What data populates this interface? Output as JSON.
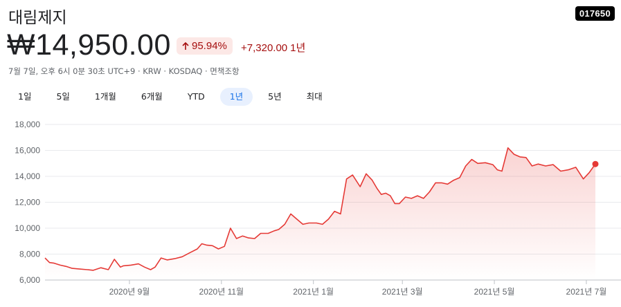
{
  "header": {
    "name": "대림제지",
    "ticker": "017650",
    "price": "₩14,950.00",
    "change_pct": "95.94%",
    "change_abs": "+7,320.00",
    "change_period": "1년",
    "meta": "7월 7일, 오후 6시 0분 30초 UTC+9 · KRW · KOSDAQ · 면책조항"
  },
  "colors": {
    "line": "#e53935",
    "fill": "#fce8e6",
    "text": "#5f6368",
    "active_tab": "#1a73e8"
  },
  "ranges": [
    {
      "label": "1일",
      "active": false
    },
    {
      "label": "5일",
      "active": false
    },
    {
      "label": "1개월",
      "active": false
    },
    {
      "label": "6개월",
      "active": false
    },
    {
      "label": "YTD",
      "active": false
    },
    {
      "label": "1년",
      "active": true
    },
    {
      "label": "5년",
      "active": false
    },
    {
      "label": "최대",
      "active": false
    }
  ],
  "chart_data": {
    "type": "area",
    "ylim": [
      6000,
      18000
    ],
    "y_ticks": [
      6000,
      8000,
      10000,
      12000,
      14000,
      16000,
      18000
    ],
    "y_tick_labels": [
      "6,000",
      "8,000",
      "10,000",
      "12,000",
      "14,000",
      "16,000",
      "18,000"
    ],
    "x_ticks": [
      {
        "date": "2020-09-01",
        "label": "2020년 9월"
      },
      {
        "date": "2020-11-01",
        "label": "2020년 11월"
      },
      {
        "date": "2021-01-01",
        "label": "2021년 1월"
      },
      {
        "date": "2021-03-01",
        "label": "2021년 3월"
      },
      {
        "date": "2021-05-01",
        "label": "2021년 5월"
      },
      {
        "date": "2021-07-01",
        "label": "2021년 7월"
      }
    ],
    "xlim": [
      "2020-07-07",
      "2021-07-07"
    ],
    "grid": true,
    "series": [
      {
        "dates": [
          "2020-07-07",
          "2020-07-10",
          "2020-07-13",
          "2020-07-17",
          "2020-07-21",
          "2020-07-25",
          "2020-07-30",
          "2020-08-04",
          "2020-08-08",
          "2020-08-13",
          "2020-08-18",
          "2020-08-22",
          "2020-08-26",
          "2020-08-28",
          "2020-09-02",
          "2020-09-07",
          "2020-09-11",
          "2020-09-15",
          "2020-09-18",
          "2020-09-22",
          "2020-09-26",
          "2020-10-01",
          "2020-10-06",
          "2020-10-11",
          "2020-10-16",
          "2020-10-19",
          "2020-10-22",
          "2020-10-26",
          "2020-10-30",
          "2020-11-03",
          "2020-11-07",
          "2020-11-11",
          "2020-11-15",
          "2020-11-19",
          "2020-11-23",
          "2020-11-27",
          "2020-12-02",
          "2020-12-06",
          "2020-12-09",
          "2020-12-13",
          "2020-12-17",
          "2020-12-21",
          "2020-12-25",
          "2020-12-29",
          "2021-01-03",
          "2021-01-07",
          "2021-01-11",
          "2021-01-15",
          "2021-01-19",
          "2021-01-23",
          "2021-01-27",
          "2021-02-01",
          "2021-02-05",
          "2021-02-09",
          "2021-02-12",
          "2021-02-15",
          "2021-02-18",
          "2021-02-21",
          "2021-02-24",
          "2021-02-27",
          "2021-03-03",
          "2021-03-07",
          "2021-03-11",
          "2021-03-15",
          "2021-03-19",
          "2021-03-23",
          "2021-03-27",
          "2021-03-31",
          "2021-04-04",
          "2021-04-08",
          "2021-04-12",
          "2021-04-16",
          "2021-04-20",
          "2021-04-25",
          "2021-04-30",
          "2021-05-03",
          "2021-05-06",
          "2021-05-10",
          "2021-05-14",
          "2021-05-18",
          "2021-05-22",
          "2021-05-26",
          "2021-05-30",
          "2021-06-04",
          "2021-06-09",
          "2021-06-14",
          "2021-06-19",
          "2021-06-24",
          "2021-06-29",
          "2021-07-03",
          "2021-07-07"
        ],
        "values": [
          7700,
          7350,
          7300,
          7150,
          7050,
          6900,
          6850,
          6800,
          6750,
          6950,
          6800,
          7600,
          7000,
          7100,
          7150,
          7250,
          7000,
          6800,
          7000,
          7700,
          7550,
          7650,
          7800,
          8100,
          8400,
          8800,
          8700,
          8650,
          8400,
          8600,
          10000,
          9200,
          9400,
          9250,
          9200,
          9600,
          9600,
          9800,
          9900,
          10300,
          11100,
          10700,
          10300,
          10400,
          10400,
          10300,
          10700,
          11300,
          11100,
          13800,
          14100,
          13200,
          14200,
          13700,
          13100,
          12600,
          12700,
          12500,
          11900,
          11900,
          12400,
          12300,
          12500,
          12300,
          12800,
          13500,
          13500,
          13400,
          13700,
          13900,
          14800,
          15300,
          15000,
          15050,
          14900,
          14500,
          14400,
          16200,
          15700,
          15500,
          15450,
          14800,
          14950,
          14800,
          14900,
          14400,
          14500,
          14700,
          13800,
          14300,
          14950
        ]
      }
    ]
  }
}
